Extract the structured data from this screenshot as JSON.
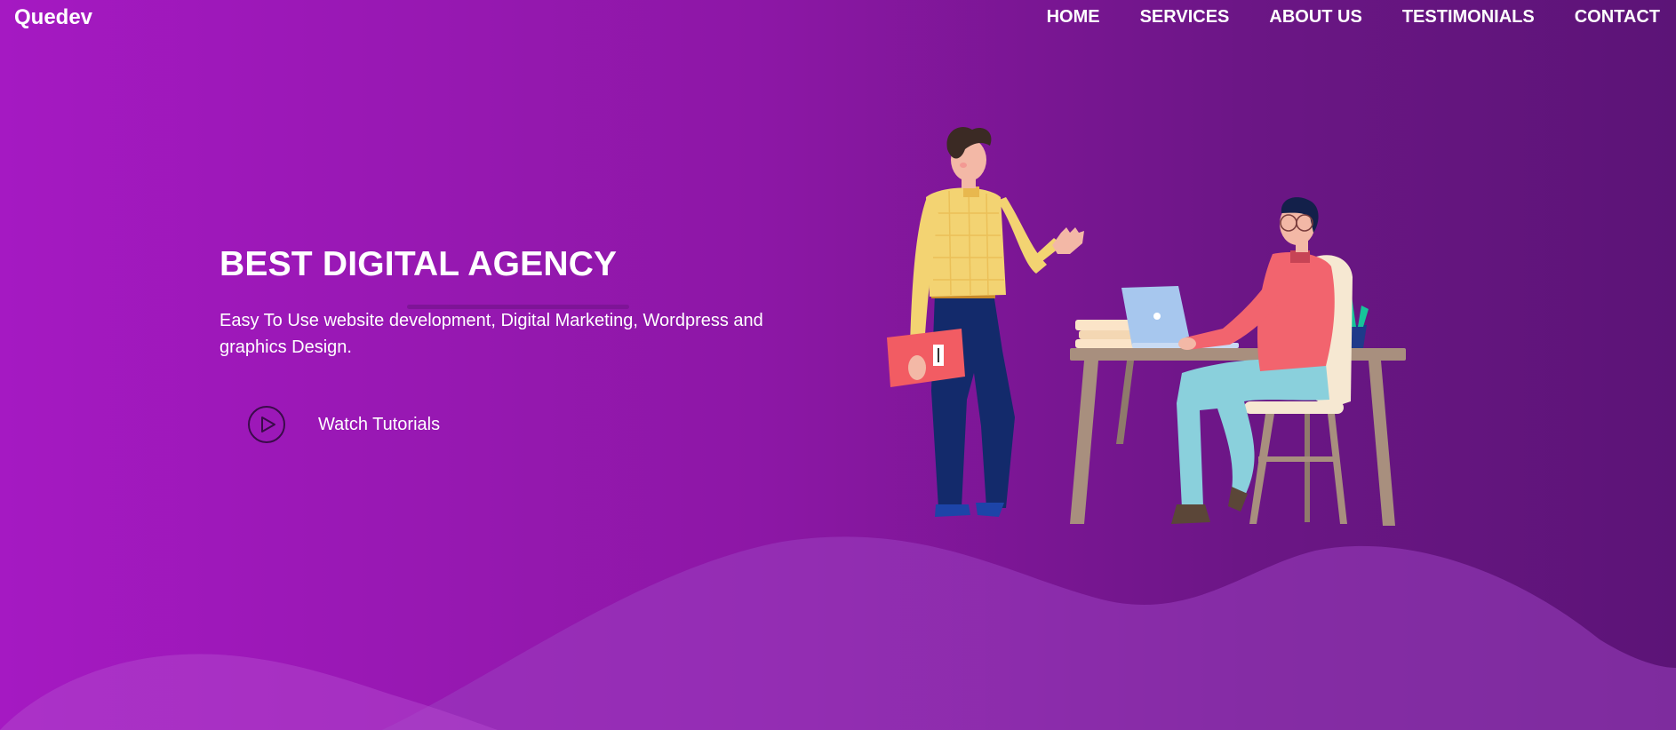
{
  "brand": {
    "name": "Quedev"
  },
  "nav": {
    "items": [
      {
        "label": "HOME"
      },
      {
        "label": "SERVICES"
      },
      {
        "label": "ABOUT US"
      },
      {
        "label": "TESTIMONIALS"
      },
      {
        "label": "CONTACT"
      }
    ]
  },
  "hero": {
    "title": "BEST DIGITAL AGENCY",
    "description": "Easy To Use website development, Digital Marketing, Wordpress and graphics Design.",
    "cta": {
      "label": "Watch Tutorials",
      "icon": "play-circle-icon"
    },
    "illustration": "office-team-illustration"
  },
  "colors": {
    "gradient_start": "#a519c2",
    "gradient_end": "#5c1477",
    "text": "#ffffff",
    "play_icon": "#3a0b4a"
  }
}
